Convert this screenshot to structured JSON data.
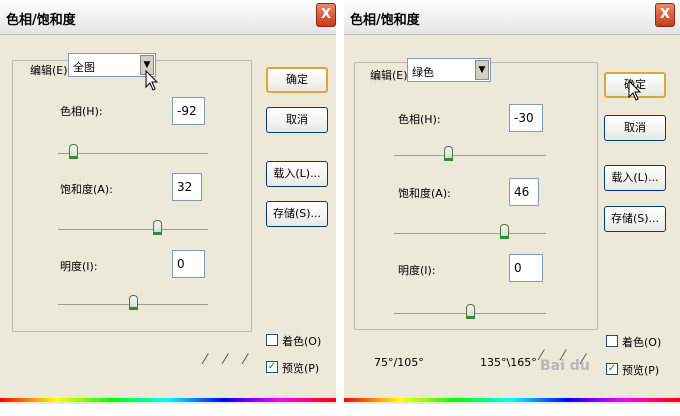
{
  "left": {
    "title": "色相/饱和度",
    "close_glyph": "X",
    "edit_label": "编辑(E):",
    "edit_value": "全图",
    "hue_label": "色相(H):",
    "hue_value": "-92",
    "hue_level_pct": 10,
    "sat_label": "饱和度(A):",
    "sat_value": "32",
    "sat_level_pct": 66,
    "light_label": "明度(I):",
    "light_value": "0",
    "light_level_pct": 50,
    "ok": "确定",
    "cancel": "取消",
    "load": "载入(L)...",
    "save": "存储(S)...",
    "colorize": "着色(O)",
    "colorize_checked": false,
    "preview": "预览(P)",
    "preview_checked": true,
    "checkmark": "✓"
  },
  "right": {
    "title": "色相/饱和度",
    "close_glyph": "X",
    "edit_label": "编辑(E):",
    "edit_value": "绿色",
    "hue_label": "色相(H):",
    "hue_value": "-30",
    "hue_level_pct": 36,
    "sat_label": "饱和度(A):",
    "sat_value": "46",
    "sat_level_pct": 73,
    "light_label": "明度(I):",
    "light_value": "0",
    "light_level_pct": 50,
    "ok": "确定",
    "cancel": "取消",
    "load": "载入(L)...",
    "save": "存储(S)...",
    "colorize": "着色(O)",
    "colorize_checked": false,
    "preview": "预览(P)",
    "preview_checked": true,
    "checkmark": "✓",
    "range_left": "75°/105°",
    "range_right": "135°\\165°",
    "watermark": "Bai du"
  },
  "icons": {
    "close": "close-icon",
    "dropdown": "chevron-down-icon",
    "eyedropper": "eyedropper-icon",
    "eyedropper_plus": "eyedropper-plus-icon",
    "eyedropper_minus": "eyedropper-minus-icon",
    "pointer": "mouse-pointer-icon"
  },
  "colors": {
    "dialog_bg": "#ece9d8",
    "close_red": "#c83a18",
    "default_button_border": "#e0a53a",
    "slider_thumb": "#2e8f2e"
  }
}
